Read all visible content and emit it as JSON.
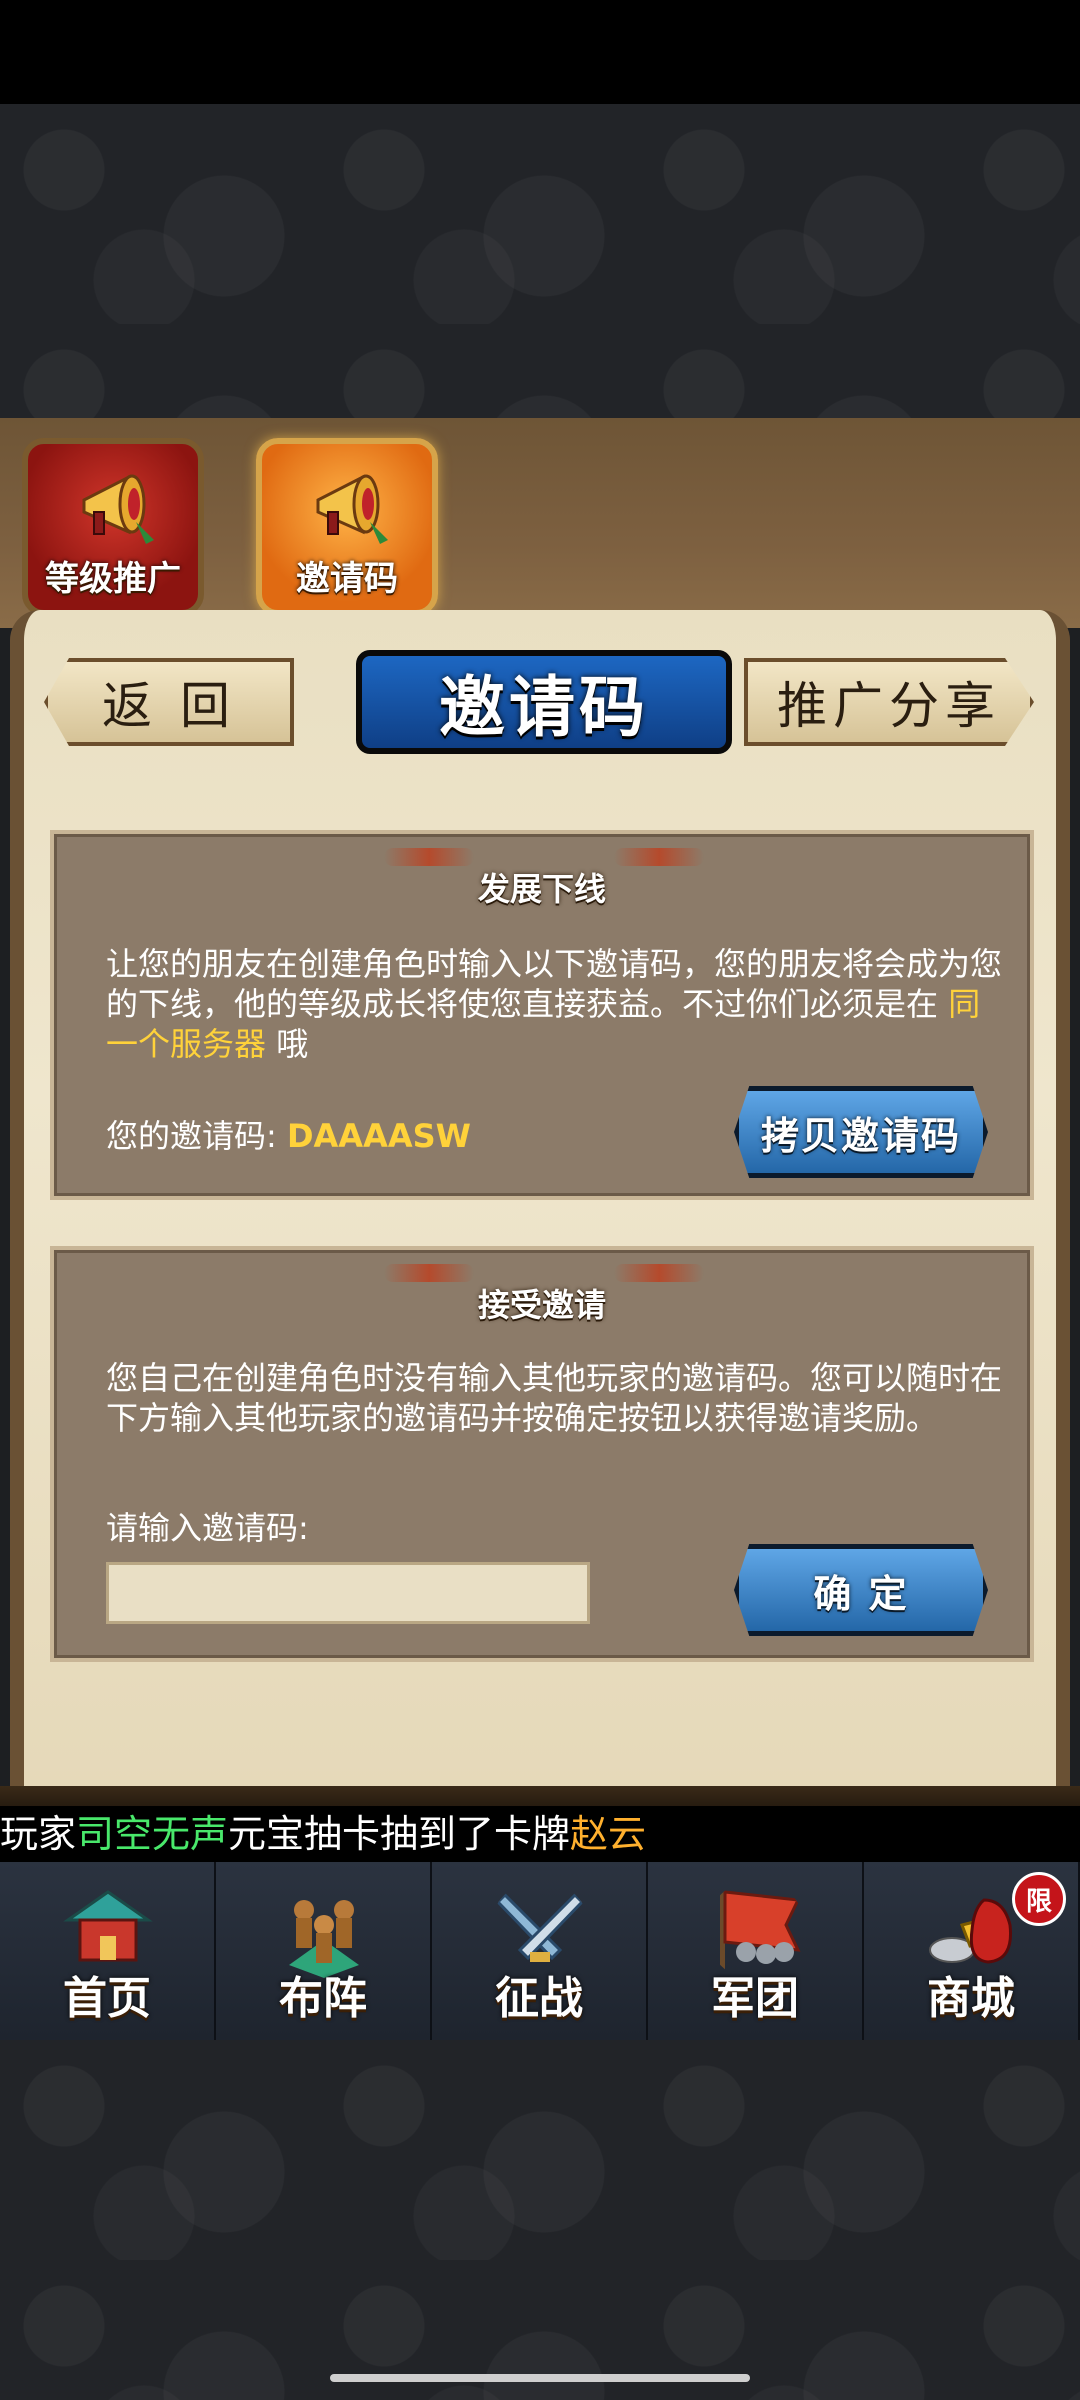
{
  "tabs": {
    "grade_promo": "等级推广",
    "invite_code": "邀请码"
  },
  "nav": {
    "back": "返 回",
    "title": "邀请码",
    "share": "推广分享"
  },
  "develop": {
    "title": "发展下线",
    "desc_part1": "让您的朋友在创建角色时输入以下邀请码，您的朋友将会成为您的下线，他的等级成长将使您直接获益。不过你们必须是在 ",
    "desc_highlight": "同一个服务器",
    "desc_part2": " 哦",
    "code_label": "您的邀请码:",
    "code_value": "DAAAASW",
    "copy_button": "拷贝邀请码"
  },
  "accept": {
    "title": "接受邀请",
    "desc": "您自己在创建角色时没有输入其他玩家的邀请码。您可以随时在下方输入其他玩家的邀请码并按确定按钮以获得邀请奖励。",
    "input_label": "请输入邀请码:",
    "input_value": "",
    "confirm_button": "确 定"
  },
  "ticker": {
    "prefix": "玩家",
    "player": "司空无声",
    "middle": "元宝抽卡抽到了卡牌",
    "card": "赵云"
  },
  "bottom_nav": {
    "home": "首页",
    "formation": "布阵",
    "battle": "征战",
    "legion": "军团",
    "shop": "商城",
    "limit_badge": "限"
  },
  "colors": {
    "highlight": "#ffd23a",
    "ticker_player": "#49e86b",
    "ticker_card": "#ffb02e"
  }
}
